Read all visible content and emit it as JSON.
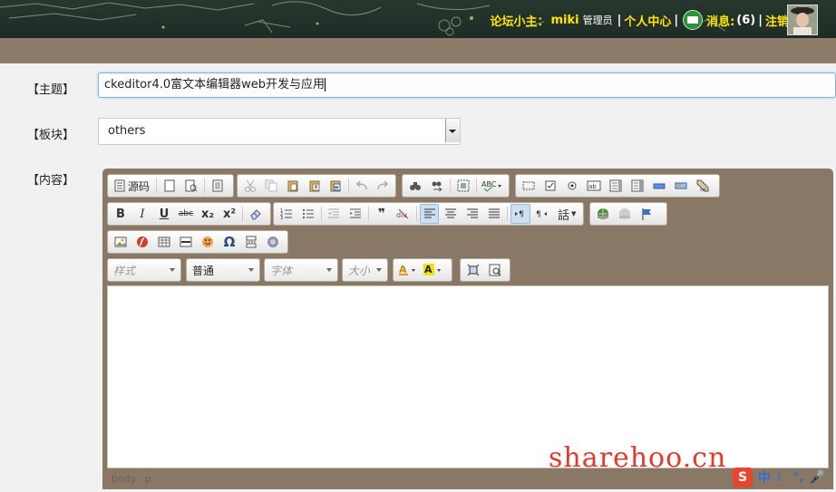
{
  "header": {
    "forum_owner_label": "论坛小主：",
    "username": "miki",
    "role": "管理员",
    "sep1": "|",
    "personal_center": "个人中心",
    "sep2": "|",
    "messages_label": "消息:",
    "messages_count": "(6)",
    "sep3": "|",
    "logout": "注销"
  },
  "form": {
    "subject_label": "【主题】",
    "subject_value": "ckeditor4.0富文本编辑器web开发与应用",
    "board_label": "【板块】",
    "board_value": "others",
    "content_label": "【内容】"
  },
  "editor": {
    "source_label": "源码",
    "combo_style": "样式",
    "combo_format": "普通",
    "combo_font": "字体",
    "combo_size": "大小",
    "bold": "B",
    "italic": "I",
    "underline": "U",
    "strike": "abc",
    "subscript": "x₂",
    "superscript": "x²",
    "blockquote": "❞",
    "omega": "Ω",
    "language": "話",
    "status_body": "body",
    "status_p": "p"
  },
  "watermark": "sharehoo.cn",
  "ime": {
    "logo": "S",
    "mode": "中"
  }
}
